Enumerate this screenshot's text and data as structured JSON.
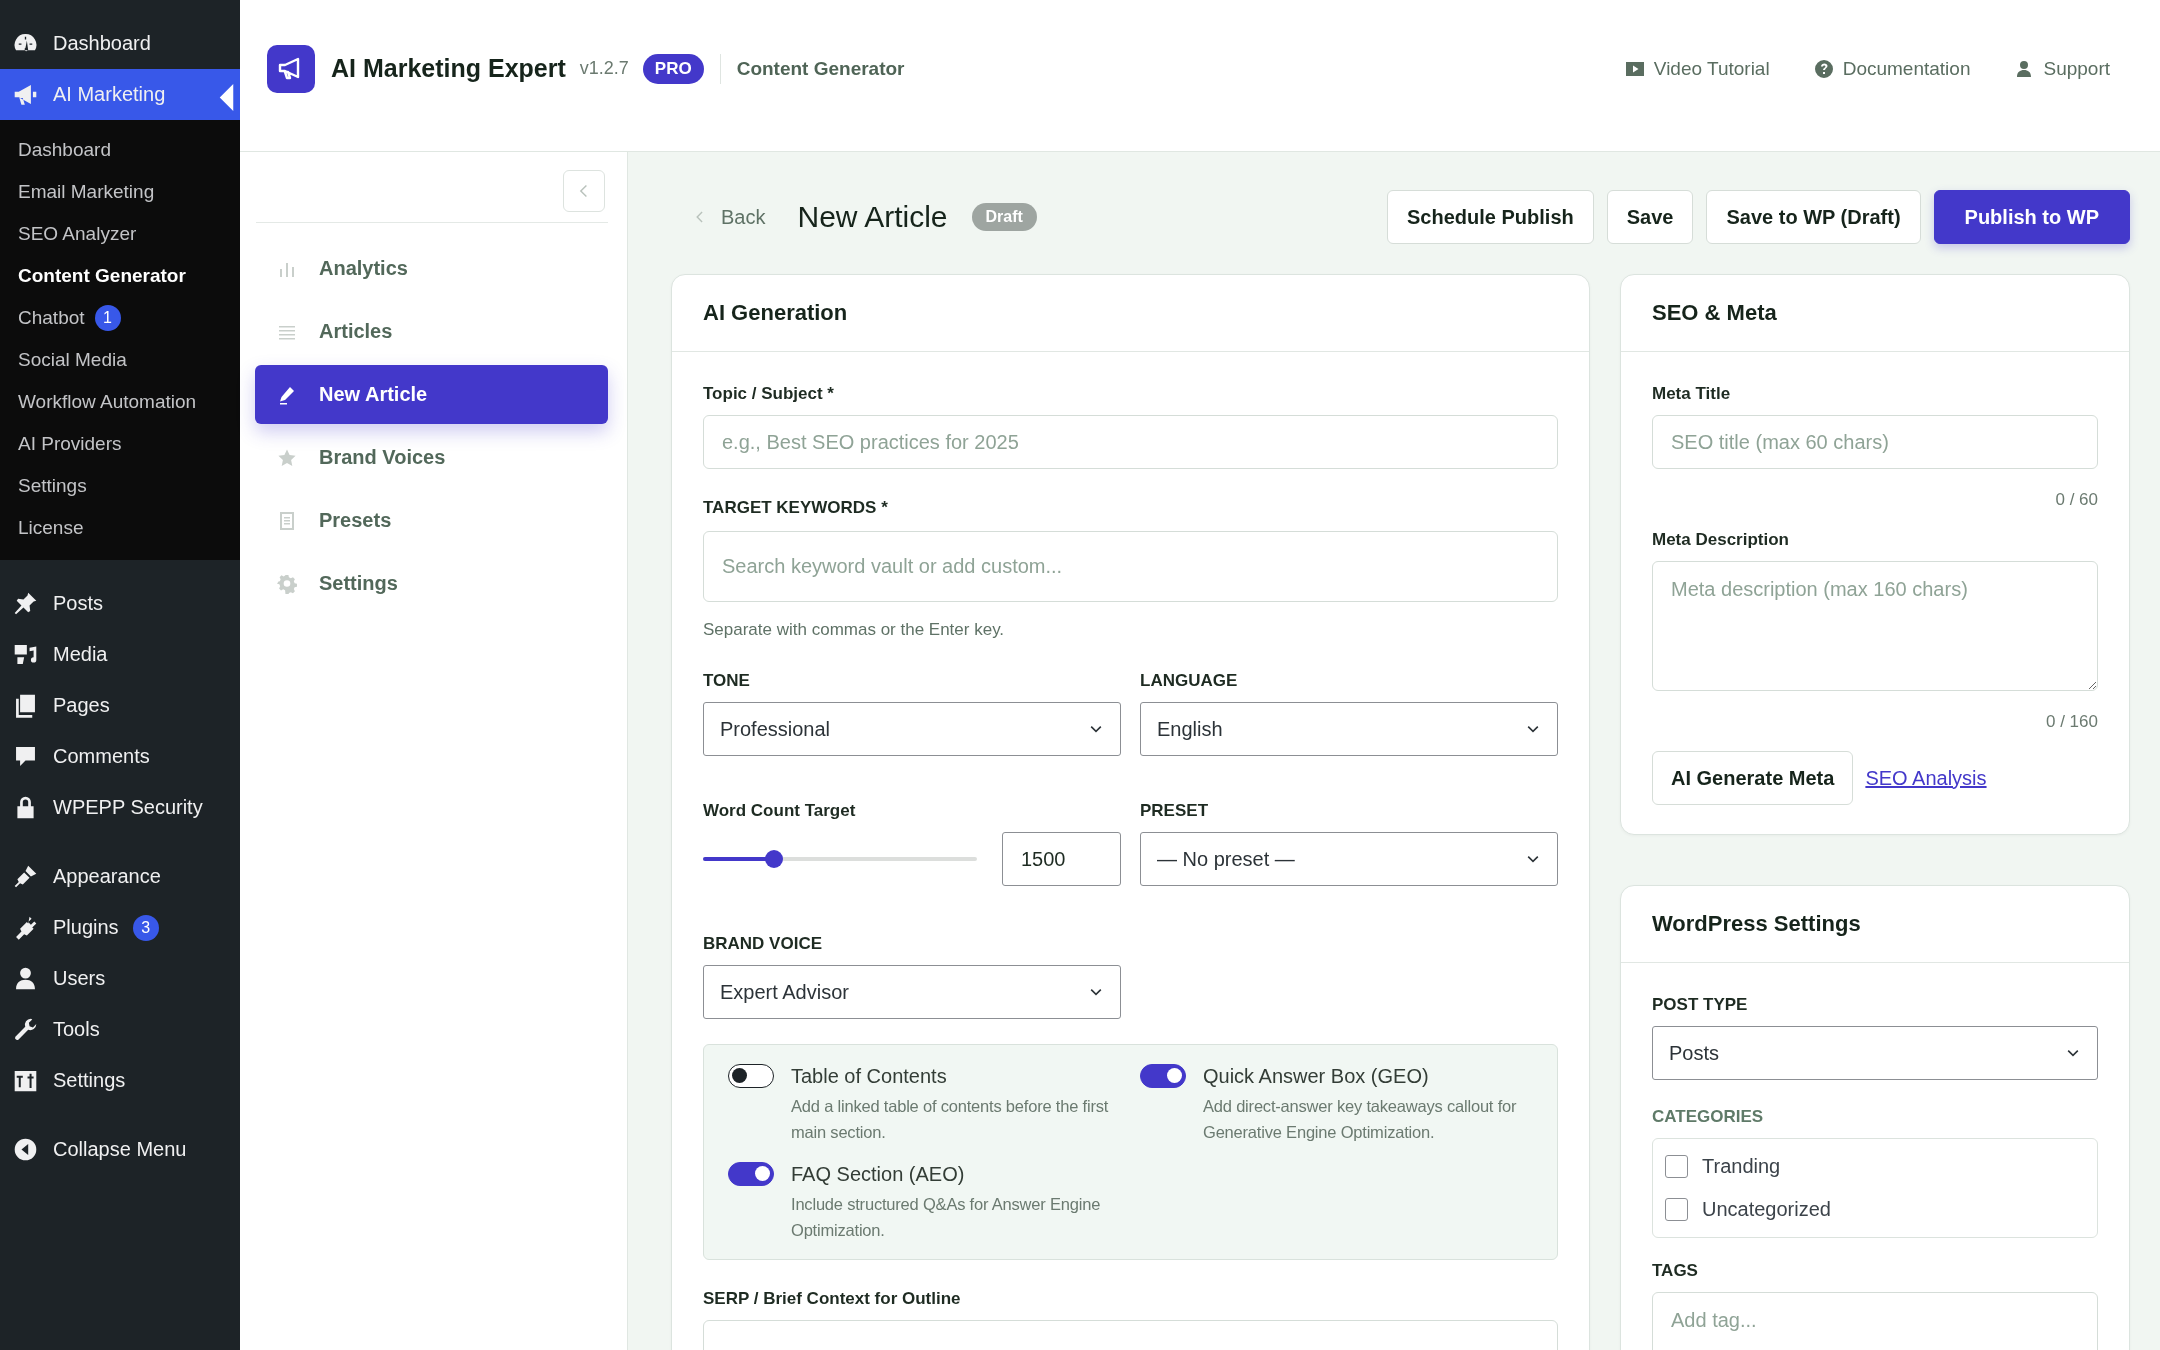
{
  "admin_menu": {
    "groups": [
      [
        {
          "label": "Dashboard",
          "selected": false
        },
        {
          "label": "AI Marketing",
          "selected": true,
          "submenu": [
            {
              "label": "Dashboard",
              "selected": false
            },
            {
              "label": "Email Marketing",
              "selected": false
            },
            {
              "label": "SEO Analyzer",
              "selected": false
            },
            {
              "label": "Content Generator",
              "selected": true
            },
            {
              "label": "Chatbot",
              "selected": false,
              "badge": "1"
            },
            {
              "label": "Social Media",
              "selected": false
            },
            {
              "label": "Workflow Automation",
              "selected": false
            },
            {
              "label": "AI Providers",
              "selected": false
            },
            {
              "label": "Settings",
              "selected": false
            },
            {
              "label": "License",
              "selected": false
            }
          ]
        }
      ],
      [
        {
          "label": "Posts",
          "selected": false
        },
        {
          "label": "Media",
          "selected": false
        },
        {
          "label": "Pages",
          "selected": false
        },
        {
          "label": "Comments",
          "selected": false
        },
        {
          "label": "WPEPP Security",
          "selected": false
        }
      ],
      [
        {
          "label": "Appearance",
          "selected": false
        },
        {
          "label": "Plugins",
          "selected": false,
          "badge": "3"
        },
        {
          "label": "Users",
          "selected": false
        },
        {
          "label": "Tools",
          "selected": false
        },
        {
          "label": "Settings",
          "selected": false
        }
      ]
    ],
    "collapse": "Collapse Menu"
  },
  "header": {
    "app_name": "AI Marketing Expert",
    "version": "v1.2.7",
    "plan": "PRO",
    "section": "Content Generator",
    "links": [
      "Video Tutorial",
      "Documentation",
      "Support"
    ]
  },
  "plugin_nav": {
    "items": [
      {
        "label": "Analytics",
        "selected": false
      },
      {
        "label": "Articles",
        "selected": false
      },
      {
        "label": "New Article",
        "selected": true
      },
      {
        "label": "Brand Voices",
        "selected": false
      },
      {
        "label": "Presets",
        "selected": false
      },
      {
        "label": "Settings",
        "selected": false
      }
    ]
  },
  "toolbar": {
    "back": "Back",
    "title": "New Article",
    "status": "Draft",
    "actions": [
      {
        "label": "Schedule Publish",
        "kind": "secondary"
      },
      {
        "label": "Save",
        "kind": "secondary"
      },
      {
        "label": "Save to WP (Draft)",
        "kind": "secondary"
      },
      {
        "label": "Publish to WP",
        "kind": "primary"
      }
    ]
  },
  "ai_generation": {
    "title": "AI Generation",
    "topic": {
      "label": "Topic / Subject *",
      "placeholder": "e.g., Best SEO practices for 2025"
    },
    "keywords": {
      "label": "TARGET KEYWORDS *",
      "placeholder": "Search keyword vault or add custom...",
      "hint": "Separate with commas or the Enter key."
    },
    "tone": {
      "label": "TONE",
      "value": "Professional"
    },
    "language": {
      "label": "LANGUAGE",
      "value": "English"
    },
    "word_count": {
      "label": "Word Count Target",
      "level": 0.26,
      "value": "1500"
    },
    "preset": {
      "label": "PRESET",
      "value": "— No preset —"
    },
    "brand_voice": {
      "label": "BRAND VOICE",
      "value": "Expert Advisor"
    },
    "options": [
      {
        "title": "Table of Contents",
        "description": "Add a linked table of contents before the first main section.",
        "on": false
      },
      {
        "title": "Quick Answer Box (GEO)",
        "description": "Add direct-answer key takeaways callout for Generative Engine Optimization.",
        "on": true
      },
      {
        "title": "FAQ Section (AEO)",
        "description": "Include structured Q&As for Answer Engine Optimization.",
        "on": true
      }
    ],
    "serp": {
      "label": "SERP / Brief Context for Outline"
    }
  },
  "seo_meta": {
    "title": "SEO & Meta",
    "meta_title": {
      "label": "Meta Title",
      "placeholder": "SEO title (max 60 chars)",
      "counter": "0 / 60"
    },
    "meta_description": {
      "label": "Meta Description",
      "placeholder": "Meta description (max 160 chars)",
      "counter": "0 / 160"
    },
    "generate_button": "AI Generate Meta",
    "analysis_link": "SEO Analysis"
  },
  "wordpress_settings": {
    "title": "WordPress Settings",
    "post_type": {
      "label": "POST TYPE",
      "value": "Posts"
    },
    "categories": {
      "label": "CATEGORIES",
      "items": [
        {
          "label": "Tranding",
          "checked": false
        },
        {
          "label": "Uncategorized",
          "checked": false
        }
      ]
    },
    "tags": {
      "label": "TAGS",
      "placeholder": "Add tag..."
    }
  }
}
